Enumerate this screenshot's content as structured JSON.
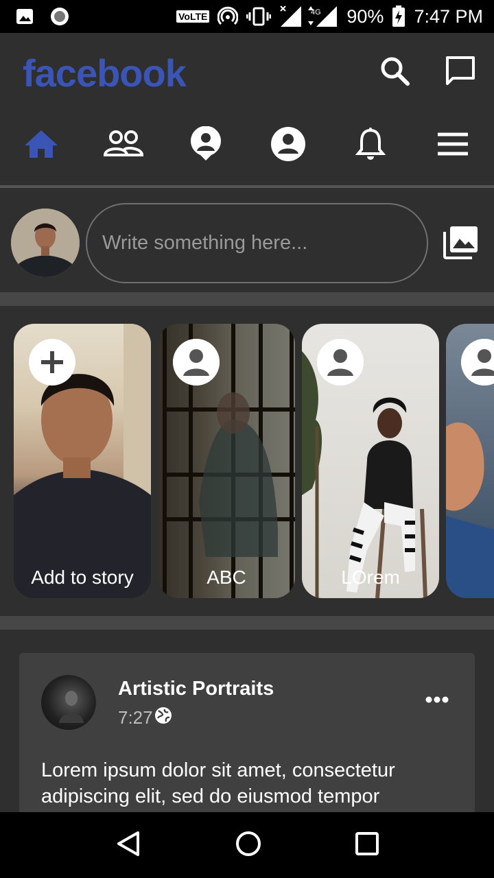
{
  "status_bar": {
    "volte": "VoLTE",
    "network": "4G",
    "battery": "90%",
    "time": "7:47 PM"
  },
  "header": {
    "logo": "facebook",
    "brand_color": "#3b55b7"
  },
  "nav_tabs": [
    {
      "name": "home-icon",
      "active": true
    },
    {
      "name": "friends-icon",
      "active": false
    },
    {
      "name": "profile-pin-icon",
      "active": false
    },
    {
      "name": "account-icon",
      "active": false
    },
    {
      "name": "bell-icon",
      "active": false
    },
    {
      "name": "menu-icon",
      "active": false
    }
  ],
  "composer": {
    "placeholder": "Write something here..."
  },
  "stories": [
    {
      "label": "Add to story",
      "badge": "plus-icon"
    },
    {
      "label": "ABC",
      "badge": "person-icon"
    },
    {
      "label": "LOrem",
      "badge": "person-icon"
    },
    {
      "label": "",
      "badge": "person-icon"
    }
  ],
  "post": {
    "author": "Artistic Portraits",
    "time": "7:27",
    "text": "Lorem ipsum dolor sit amet, consectetur adipiscing elit, sed do eiusmod tempor"
  }
}
